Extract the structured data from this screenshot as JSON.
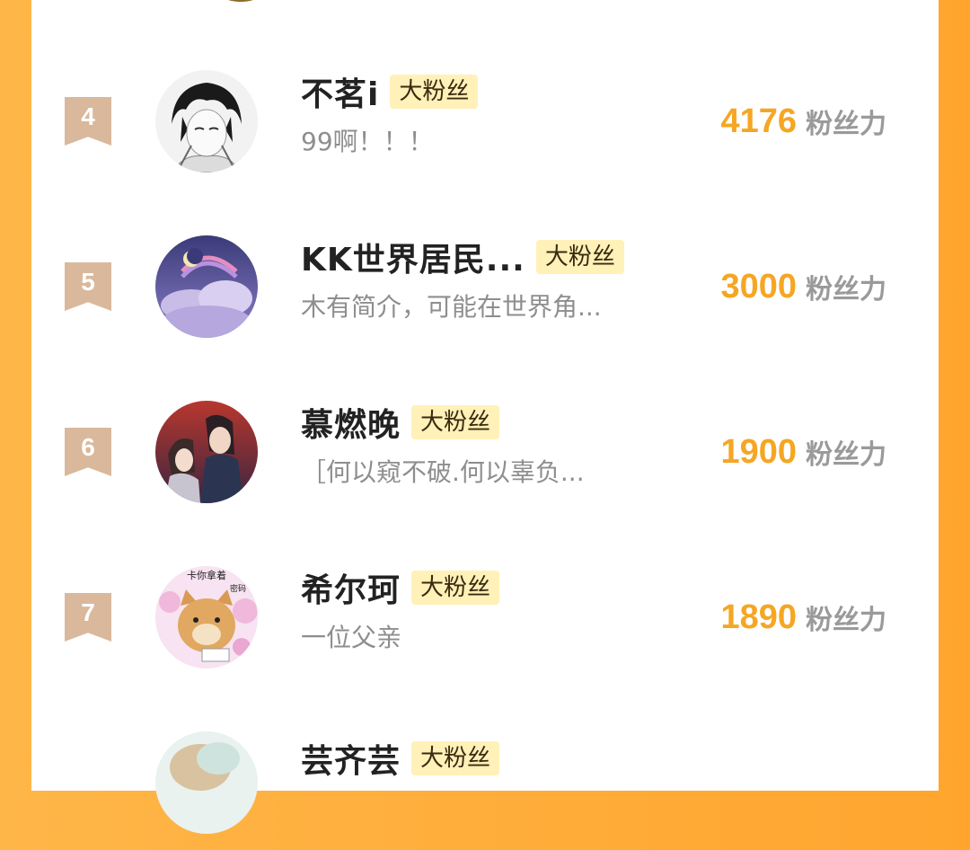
{
  "ranking": {
    "rows": [
      {
        "rank": "4",
        "name": "不茗i",
        "badge": "大粉丝",
        "bio": "99啊！！！",
        "score": "4176",
        "score_unit": "粉丝力"
      },
      {
        "rank": "5",
        "name": "KK世界居民...",
        "badge": "大粉丝",
        "bio": "木有简介，可能在世界角...",
        "score": "3000",
        "score_unit": "粉丝力"
      },
      {
        "rank": "6",
        "name": "慕燃晚",
        "badge": "大粉丝",
        "bio": "［何以窥不破.何以辜负...",
        "score": "1900",
        "score_unit": "粉丝力"
      },
      {
        "rank": "7",
        "name": "希尔珂",
        "badge": "大粉丝",
        "bio": "一位父亲",
        "score": "1890",
        "score_unit": "粉丝力"
      },
      {
        "rank": "",
        "name": "芸齐芸",
        "badge": "大粉丝",
        "bio": "",
        "score": "",
        "score_unit": ""
      }
    ]
  },
  "avatar_texts": {
    "row7_top": "卡你拿着",
    "row7_side": "密码"
  },
  "colors": {
    "background": "#ffa52e",
    "card": "#ffffff",
    "score": "#f5a623",
    "badge_bg": "#fff1b8",
    "rank_badge": "#d9b89c"
  }
}
